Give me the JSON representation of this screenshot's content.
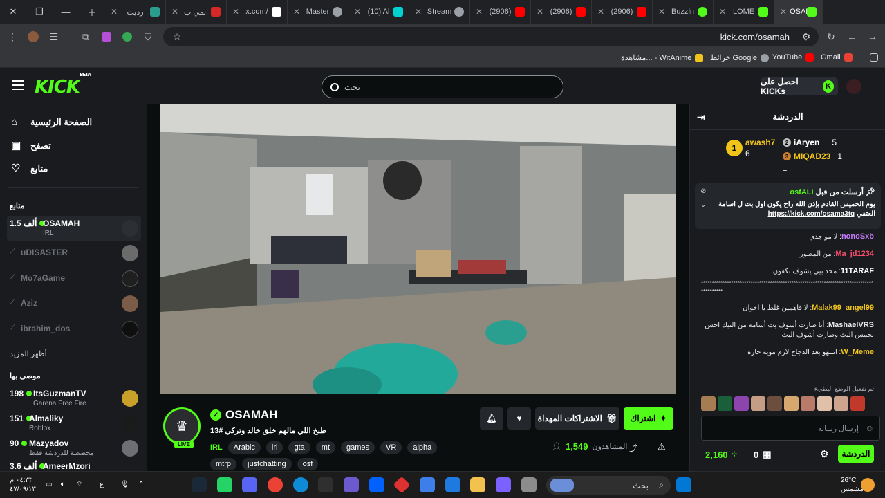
{
  "browser": {
    "tabs": [
      {
        "title": "OSAM",
        "active": true,
        "fav": "#53fc18"
      },
      {
        "title": "LOME",
        "active": false,
        "fav": "#53fc18"
      },
      {
        "title": "Buzzln",
        "active": false,
        "fav": "#53fc18"
      },
      {
        "title": "(2906)",
        "active": false,
        "fav": "#ff0000"
      },
      {
        "title": "(2906)",
        "active": false,
        "fav": "#ff0000"
      },
      {
        "title": "(2906)",
        "active": false,
        "fav": "#ff0000"
      },
      {
        "title": "Stream",
        "active": false,
        "fav": "#9aa0a6"
      },
      {
        "title": "(10) Al",
        "active": false,
        "fav": "#00d2d2"
      },
      {
        "title": "Master",
        "active": false,
        "fav": "#9aa0a6"
      },
      {
        "title": "x.com/",
        "active": false,
        "fav": "#ffffff"
      },
      {
        "title": "انمي ب",
        "active": false,
        "fav": "#d62828"
      },
      {
        "title": "رديت",
        "active": false,
        "fav": "#2a9d8f"
      }
    ],
    "url": "kick.com/osamah",
    "bookmarks": [
      "Gmail",
      "YouTube",
      "خرائط Google",
      "مشاهدة... - WitAnime"
    ]
  },
  "header": {
    "logo": "KICK",
    "beta": "BETA",
    "search_placeholder": "بحث",
    "get_kicks": "احصل على KICKs"
  },
  "sidebar": {
    "nav": [
      {
        "label": "الصفحة الرئيسية",
        "icon": "home-icon",
        "glyph": "⌂"
      },
      {
        "label": "تصفح",
        "icon": "browse-icon",
        "glyph": "▣"
      },
      {
        "label": "متابع",
        "icon": "heart-icon",
        "glyph": "♡"
      }
    ],
    "following_title": "متابع",
    "following": [
      {
        "name": "OSAMAH",
        "count": "1.5 ألف",
        "sub": "IRL",
        "live": true
      },
      {
        "name": "uDISASTER",
        "live": false
      },
      {
        "name": "Mo7aGame",
        "live": false
      },
      {
        "name": "Aziz",
        "live": false
      },
      {
        "name": "ibrahim_dos",
        "live": false
      }
    ],
    "show_more": "أظهر المزيد",
    "recommended_title": "موصى بها",
    "recommended": [
      {
        "name": "ItsGuzmanTV",
        "count": "198",
        "sub": "Garena Free Fire"
      },
      {
        "name": "Almaliky",
        "count": "151",
        "sub": "Roblox"
      },
      {
        "name": "Mazyadov",
        "count": "90",
        "sub": "مخصصة للدردشة فقط"
      },
      {
        "name": "AmeerMzori",
        "count": "3.6 ألف",
        "sub": ""
      }
    ]
  },
  "stream": {
    "name": "OSAMAH",
    "title": "طبخ اللي مالهم خلق خالد وتركي #13",
    "live_label": "LIVE",
    "category": "IRL",
    "tags": [
      "Arabic",
      "irl",
      "gta",
      "mt",
      "games",
      "VR",
      "alpha",
      "mtrp",
      "justchatting",
      "osf"
    ],
    "subscribe": "اشتراك",
    "gift": "الاشتراكات المهداة",
    "viewers_label": "المشاهدون",
    "viewers": "1,549"
  },
  "chat": {
    "title": "الدردشة",
    "leaderboard": [
      {
        "rank": "1",
        "name": "awash7",
        "count": "6",
        "color": "#f0c419"
      },
      {
        "rank": "2",
        "name": "iAryen",
        "count": "5",
        "color": "#c0c0c0"
      },
      {
        "rank": "3",
        "name": "MIQAD23",
        "count": "1",
        "color": "#cd7f32"
      }
    ],
    "pinned_by": "osfALI",
    "pinned_label": "أرسلت من قبل",
    "pinned_msg": "يوم الخميس القادم بإذن الله راح يكون اول بث ل اسامة العتقي",
    "pinned_link": "https://kick.com/osama3tq",
    "messages": [
      {
        "user": "nonoSxb",
        "text": "لا مو جدي",
        "color": "#c77dff"
      },
      {
        "user": "Ma_jd1234",
        "text": "من المصور",
        "color": "#ff4d6d"
      },
      {
        "user": "11TARAF",
        "text": "محد بيي يشوف نكفون",
        "color": "#ffffff"
      },
      {
        "user": "",
        "text": "******************************************************************************************",
        "color": "#ffffff"
      },
      {
        "user": "Malak99_angel99",
        "text": "لا قاهمين غلط يا اخوان",
        "color": "#f0c419"
      },
      {
        "user": "MashaelVRS",
        "text": "أنا صارت أشوف بث أسامه من التيك احس بحمس البث وصارت أشوف البث",
        "color": "#e6e6e6"
      },
      {
        "user": "W_Meme",
        "text": "انتبهو بعد الدجاج لازم مويه حاره",
        "color": "#f0c419"
      }
    ],
    "slow_mode": "تم تفعيل الوضع البطيء",
    "input_placeholder": "إرسال رسالة",
    "points": "2,160",
    "zero": "0",
    "chat_button": "الدردشة"
  },
  "taskbar": {
    "search_placeholder": "بحث",
    "weather": "26°C",
    "weather_desc": "مشمس",
    "time": "٠٤:٣٣ م",
    "date": "٤٧/٠٩/١٣"
  }
}
